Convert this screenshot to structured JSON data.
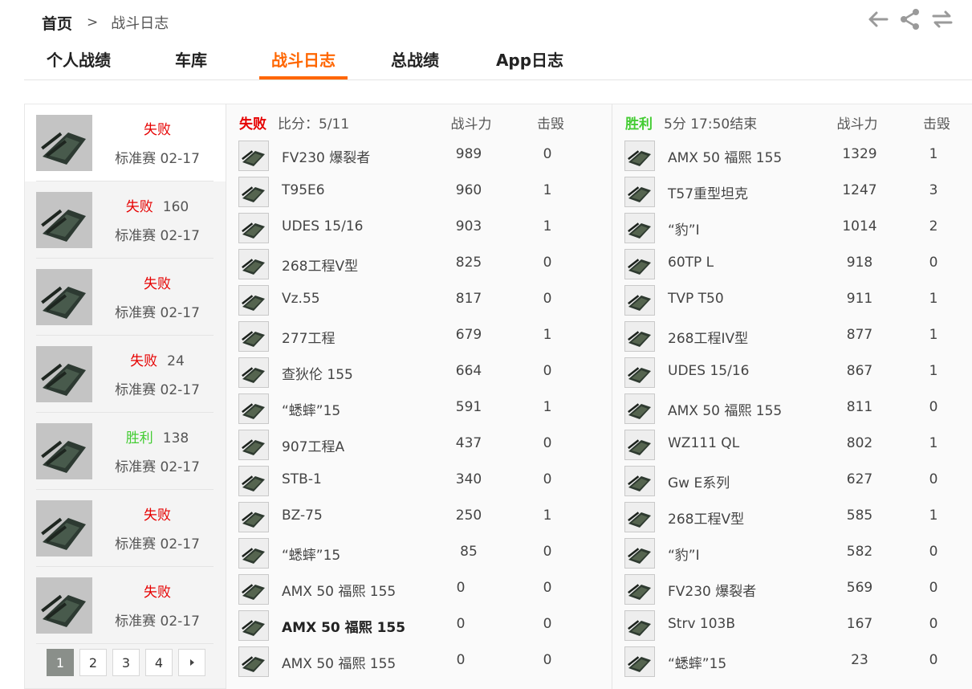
{
  "breadcrumb": {
    "home": "首页",
    "separator": ">",
    "current": "战斗日志"
  },
  "tabs": [
    {
      "label": "个人战绩",
      "active": false
    },
    {
      "label": "车库",
      "active": false
    },
    {
      "label": "战斗日志",
      "active": true
    },
    {
      "label": "总战绩",
      "active": false
    },
    {
      "label": "App日志",
      "active": false
    }
  ],
  "icons": {
    "back": "arrow-left-icon",
    "share": "share-icon",
    "refresh": "refresh-icon"
  },
  "colors": {
    "accent": "#ff6600",
    "loss": "#e60000",
    "win": "#44cc33"
  },
  "battles": [
    {
      "result": "失败",
      "score": "",
      "mode": "标准赛 02-17",
      "selected": true
    },
    {
      "result": "失败",
      "score": "160",
      "mode": "标准赛 02-17"
    },
    {
      "result": "失败",
      "score": "",
      "mode": "标准赛 02-17"
    },
    {
      "result": "失败",
      "score": "24",
      "mode": "标准赛 02-17"
    },
    {
      "result": "胜利",
      "score": "138",
      "mode": "标准赛 02-17"
    },
    {
      "result": "失败",
      "score": "",
      "mode": "标准赛 02-17"
    },
    {
      "result": "失败",
      "score": "",
      "mode": "标准赛 02-17"
    }
  ],
  "pagination": {
    "pages": [
      "1",
      "2",
      "3",
      "4"
    ],
    "current": "1",
    "next_icon": "caret-right-icon"
  },
  "team_left": {
    "result": "失败",
    "info": "比分：5/11",
    "power_header": "战斗力",
    "kills_header": "击毁",
    "players": [
      {
        "tank": "FV230 爆裂者",
        "power": "989",
        "kills": "0"
      },
      {
        "tank": "T95E6",
        "power": "960",
        "kills": "1"
      },
      {
        "tank": "UDES 15/16",
        "power": "903",
        "kills": "1"
      },
      {
        "tank": "268工程V型",
        "power": "825",
        "kills": "0"
      },
      {
        "tank": "Vz.55",
        "power": "817",
        "kills": "0"
      },
      {
        "tank": "277工程",
        "power": "679",
        "kills": "1"
      },
      {
        "tank": "查狄伦 155",
        "power": "664",
        "kills": "0"
      },
      {
        "tank": "“蟋蟀”15",
        "power": "591",
        "kills": "1"
      },
      {
        "tank": "907工程A",
        "power": "437",
        "kills": "0"
      },
      {
        "tank": "STB-1",
        "power": "340",
        "kills": "0"
      },
      {
        "tank": "BZ-75",
        "power": "250",
        "kills": "1"
      },
      {
        "tank": "“蟋蟀”15",
        "power": "85",
        "kills": "0"
      },
      {
        "tank": "AMX 50 福熙 155",
        "power": "0",
        "kills": "0"
      },
      {
        "tank": "AMX 50 福熙 155",
        "power": "0",
        "kills": "0",
        "self": true
      },
      {
        "tank": "AMX 50 福熙 155",
        "power": "0",
        "kills": "0"
      }
    ]
  },
  "team_right": {
    "result": "胜利",
    "info": "5分 17:50结束",
    "power_header": "战斗力",
    "kills_header": "击毁",
    "players": [
      {
        "tank": "AMX 50 福熙 155",
        "power": "1329",
        "kills": "1"
      },
      {
        "tank": "T57重型坦克",
        "power": "1247",
        "kills": "3"
      },
      {
        "tank": "“豹”I",
        "power": "1014",
        "kills": "2"
      },
      {
        "tank": "60TP L",
        "power": "918",
        "kills": "0"
      },
      {
        "tank": "TVP T50",
        "power": "911",
        "kills": "1"
      },
      {
        "tank": "268工程IV型",
        "power": "877",
        "kills": "1"
      },
      {
        "tank": "UDES 15/16",
        "power": "867",
        "kills": "1"
      },
      {
        "tank": "AMX 50 福熙 155",
        "power": "811",
        "kills": "0"
      },
      {
        "tank": "WZ111 QL",
        "power": "802",
        "kills": "1"
      },
      {
        "tank": "Gw E系列",
        "power": "627",
        "kills": "0"
      },
      {
        "tank": "268工程V型",
        "power": "585",
        "kills": "1"
      },
      {
        "tank": "“豹”I",
        "power": "582",
        "kills": "0"
      },
      {
        "tank": "FV230 爆裂者",
        "power": "569",
        "kills": "0"
      },
      {
        "tank": "Strv 103B",
        "power": "167",
        "kills": "0"
      },
      {
        "tank": "“蟋蟀”15",
        "power": "23",
        "kills": "0"
      }
    ]
  }
}
